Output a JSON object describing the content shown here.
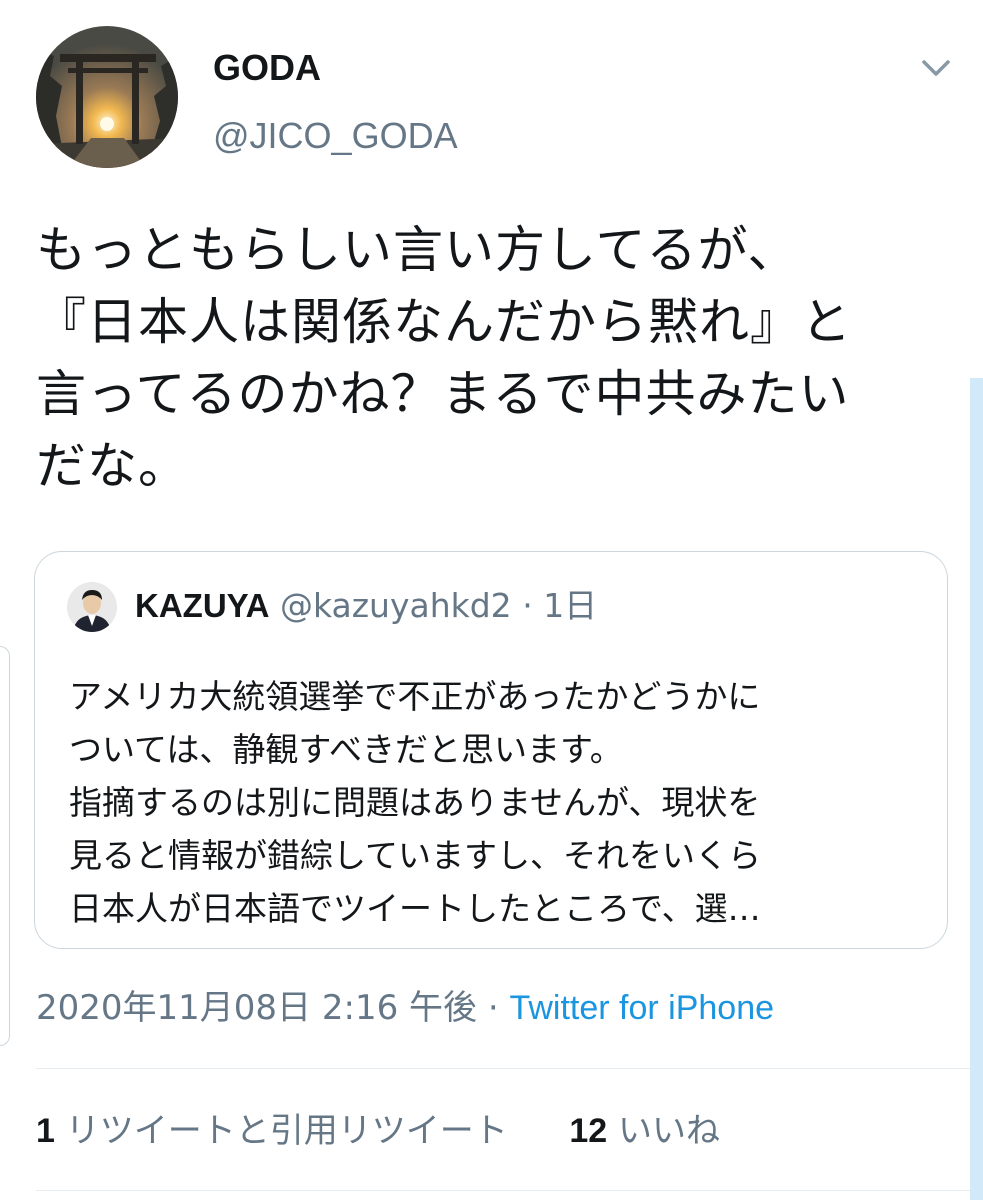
{
  "tweet": {
    "author": {
      "display_name": "GODA",
      "handle": "@JICO_GODA"
    },
    "text_lines": [
      "もっともらしい言い方してるが、",
      "『日本人は関係なんだから黙れ』と",
      "言ってるのかね？まるで中共みたい",
      "だな。"
    ],
    "quoted": {
      "display_name": "KAZUYA",
      "handle": "@kazuyahkd2",
      "separator": "·",
      "time": "1日",
      "text_lines": [
        "アメリカ大統領選挙で不正があったかどうかに",
        "ついては、静観すべきだと思います。",
        "指摘するのは別に問題はありませんが、現状を",
        "見ると情報が錯綜していますし、それをいくら",
        "日本人が日本語でツイートしたところで、選…"
      ]
    },
    "timestamp": "2020年11月08日 2:16 午後",
    "meta_separator": "·",
    "source": "Twitter for iPhone",
    "stats": {
      "retweets_count": "1",
      "retweets_label": "リツイートと引用リツイート",
      "likes_count": "12",
      "likes_label": "いいね"
    }
  },
  "icons": {
    "menu": "chevron-down-icon",
    "avatar": "torii-sunset-avatar",
    "quoted_avatar": "person-avatar"
  },
  "colors": {
    "text_primary": "#14171a",
    "text_secondary": "#657786",
    "link": "#1b95e0",
    "border": "#ccd6dd",
    "divider": "#e6ecf0",
    "scrollbar": "#d2e9fa"
  }
}
